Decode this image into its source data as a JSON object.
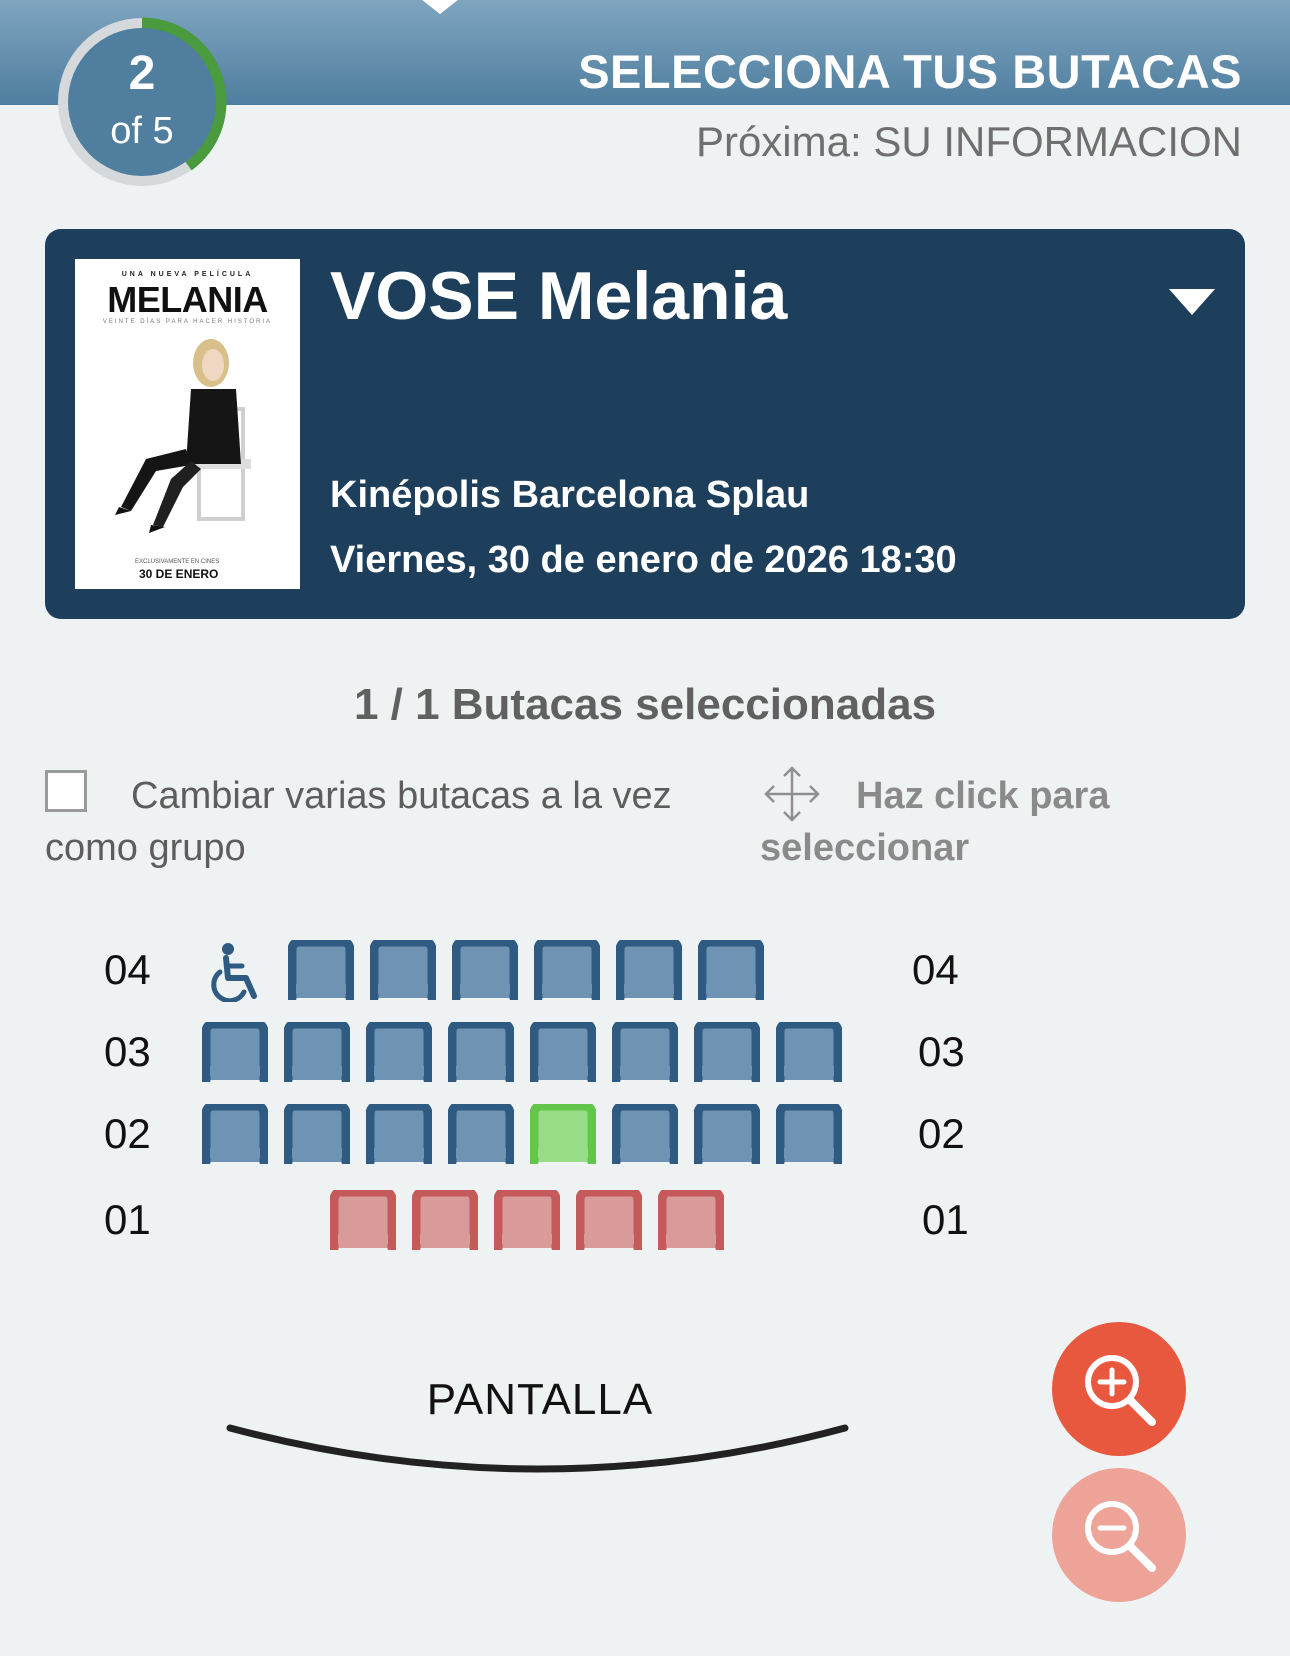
{
  "header": {
    "step_current": "2",
    "step_total_label": "of 5",
    "step_progress": 0.4,
    "title": "SELECCIONA TUS BUTACAS",
    "next_step": "Próxima: SU INFORMACION"
  },
  "movie": {
    "title": "VOSE Melania",
    "cinema": "Kinépolis Barcelona Splau",
    "datetime": "Viernes, 30 de enero de 2026 18:30",
    "poster": {
      "tagline": "UNA NUEVA PELÍCULA",
      "title": "MELANIA",
      "subtitle": "VEINTE DÍAS PARA HACER HISTORIA",
      "small_text": "EXCLUSIVAMENTE EN CINES",
      "date": "30 DE ENERO"
    }
  },
  "selection": {
    "count_label": "1 / 1 Butacas seleccionadas",
    "group_change_label": "Cambiar varias butacas a la vez como grupo",
    "group_change_checked": false,
    "hint": "Haz click para seleccionar"
  },
  "seatmap": {
    "colors": {
      "available": "#2f5b82",
      "available_fill": "#6f94b3",
      "selected": "#62c64a",
      "selected_fill": "#97dc86",
      "occupied": "#c45a5a",
      "occupied_fill": "#d99a9a"
    },
    "rows": [
      {
        "label": "04",
        "wheelchair": true,
        "seats": [
          "available",
          "available",
          "available",
          "available",
          "available",
          "available"
        ]
      },
      {
        "label": "03",
        "wheelchair": false,
        "seats": [
          "available",
          "available",
          "available",
          "available",
          "available",
          "available",
          "available",
          "available"
        ]
      },
      {
        "label": "02",
        "wheelchair": false,
        "seats": [
          "available",
          "available",
          "available",
          "available",
          "selected",
          "available",
          "available",
          "available"
        ]
      },
      {
        "label": "01",
        "wheelchair": false,
        "seats": [
          "occupied",
          "occupied",
          "occupied",
          "occupied",
          "occupied"
        ]
      }
    ],
    "screen_label": "PANTALLA"
  },
  "zoom": {
    "in_icon": "zoom-in-icon",
    "out_icon": "zoom-out-icon"
  }
}
